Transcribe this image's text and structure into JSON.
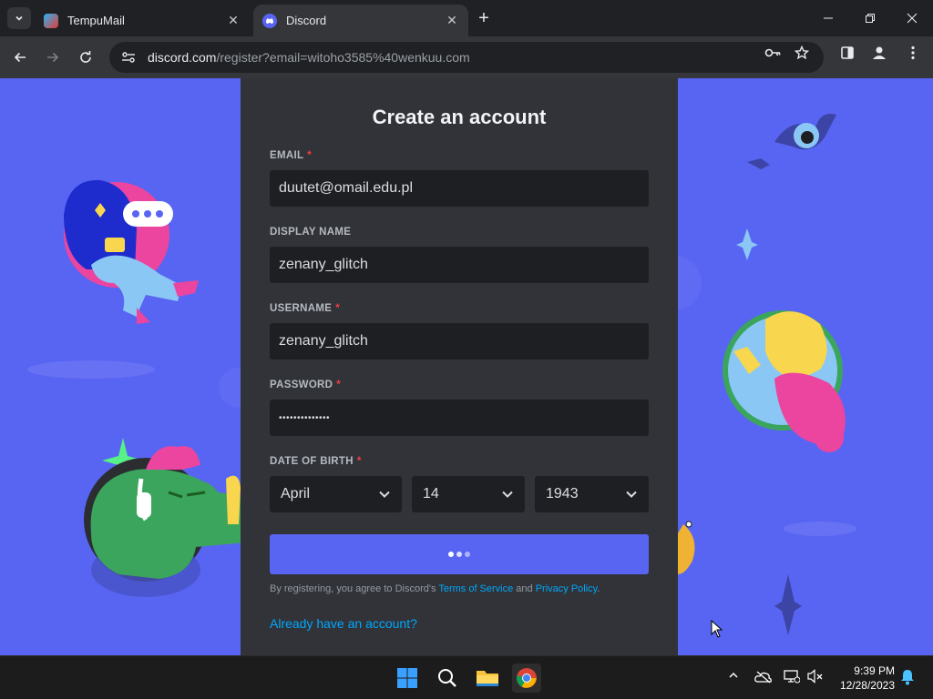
{
  "browser": {
    "tabs": [
      {
        "title": "TempuMail",
        "active": false
      },
      {
        "title": "Discord",
        "active": true
      }
    ],
    "url_host": "discord.com",
    "url_rest": "/register?email=witoho3585%40wenkuu.com"
  },
  "form": {
    "title": "Create an account",
    "email_label": "EMAIL",
    "email_value": "duutet@omail.edu.pl",
    "display_name_label": "DISPLAY NAME",
    "display_name_value": "zenany_glitch",
    "username_label": "USERNAME",
    "username_value": "zenany_glitch",
    "password_label": "PASSWORD",
    "password_value": "••••••••••••••",
    "dob_label": "DATE OF BIRTH",
    "dob_month": "April",
    "dob_day": "14",
    "dob_year": "1943",
    "required_mark": "*",
    "terms_prefix": "By registering, you agree to Discord's ",
    "terms_link": "Terms of Service",
    "terms_and": " and ",
    "privacy_link": "Privacy Policy",
    "terms_suffix": ".",
    "login_link": "Already have an account?"
  },
  "taskbar": {
    "time": "9:39 PM",
    "date": "12/28/2023"
  },
  "colors": {
    "brand": "#5865f2",
    "panel": "#313338",
    "input": "#1e1f22",
    "link": "#00a8fc",
    "required": "#f23f43"
  }
}
